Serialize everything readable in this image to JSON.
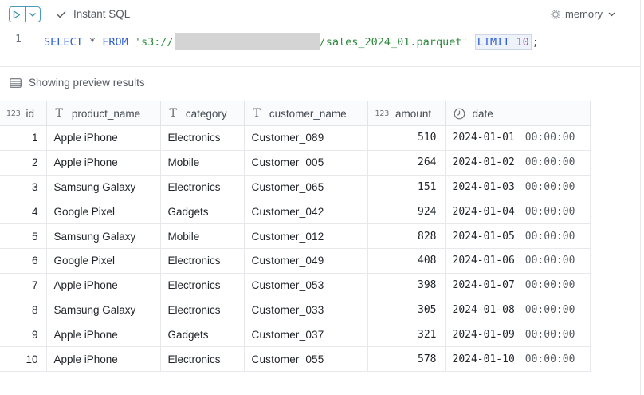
{
  "toolbar": {
    "instant_sql_label": "Instant SQL",
    "memory_label": "memory"
  },
  "editor": {
    "line_number": "1",
    "kw_select": "SELECT",
    "star": "*",
    "kw_from": "FROM",
    "path_prefix": "'s3://",
    "path_suffix": "/sales_2024_01.parquet'",
    "kw_limit": "LIMIT",
    "limit_value": "10",
    "terminator": ";"
  },
  "preview": {
    "label": "Showing preview results"
  },
  "table": {
    "columns": [
      {
        "type": "123",
        "name": "id"
      },
      {
        "type": "T",
        "name": "product_name"
      },
      {
        "type": "T",
        "name": "category"
      },
      {
        "type": "T",
        "name": "customer_name"
      },
      {
        "type": "123",
        "name": "amount"
      },
      {
        "type": "clock",
        "name": "date"
      }
    ],
    "rows": [
      {
        "id": "1",
        "product_name": "Apple iPhone",
        "category": "Electronics",
        "customer_name": "Customer_089",
        "amount": "510",
        "date": "2024-01-01",
        "time": "00:00:00"
      },
      {
        "id": "2",
        "product_name": "Apple iPhone",
        "category": "Mobile",
        "customer_name": "Customer_005",
        "amount": "264",
        "date": "2024-01-02",
        "time": "00:00:00"
      },
      {
        "id": "3",
        "product_name": "Samsung Galaxy",
        "category": "Electronics",
        "customer_name": "Customer_065",
        "amount": "151",
        "date": "2024-01-03",
        "time": "00:00:00"
      },
      {
        "id": "4",
        "product_name": "Google Pixel",
        "category": "Gadgets",
        "customer_name": "Customer_042",
        "amount": "924",
        "date": "2024-01-04",
        "time": "00:00:00"
      },
      {
        "id": "5",
        "product_name": "Samsung Galaxy",
        "category": "Mobile",
        "customer_name": "Customer_012",
        "amount": "828",
        "date": "2024-01-05",
        "time": "00:00:00"
      },
      {
        "id": "6",
        "product_name": "Google Pixel",
        "category": "Electronics",
        "customer_name": "Customer_049",
        "amount": "408",
        "date": "2024-01-06",
        "time": "00:00:00"
      },
      {
        "id": "7",
        "product_name": "Apple iPhone",
        "category": "Electronics",
        "customer_name": "Customer_053",
        "amount": "398",
        "date": "2024-01-07",
        "time": "00:00:00"
      },
      {
        "id": "8",
        "product_name": "Samsung Galaxy",
        "category": "Electronics",
        "customer_name": "Customer_033",
        "amount": "305",
        "date": "2024-01-08",
        "time": "00:00:00"
      },
      {
        "id": "9",
        "product_name": "Apple iPhone",
        "category": "Gadgets",
        "customer_name": "Customer_037",
        "amount": "321",
        "date": "2024-01-09",
        "time": "00:00:00"
      },
      {
        "id": "10",
        "product_name": "Apple iPhone",
        "category": "Electronics",
        "customer_name": "Customer_055",
        "amount": "578",
        "date": "2024-01-10",
        "time": "00:00:00"
      }
    ]
  },
  "icons": {
    "run": "play-icon",
    "run_dropdown": "chevron-down-icon",
    "instant_sql": "check-icon",
    "memory": "gear-icon",
    "memory_dropdown": "chevron-down-icon",
    "preview": "table-icon",
    "type_number": "number-type-icon",
    "type_text": "text-type-icon",
    "type_datetime": "clock-icon"
  },
  "colors": {
    "run_button_border": "#4a9bb8",
    "keyword": "#2f5fd1",
    "string": "#2f8a3e",
    "number": "#a0559a"
  }
}
